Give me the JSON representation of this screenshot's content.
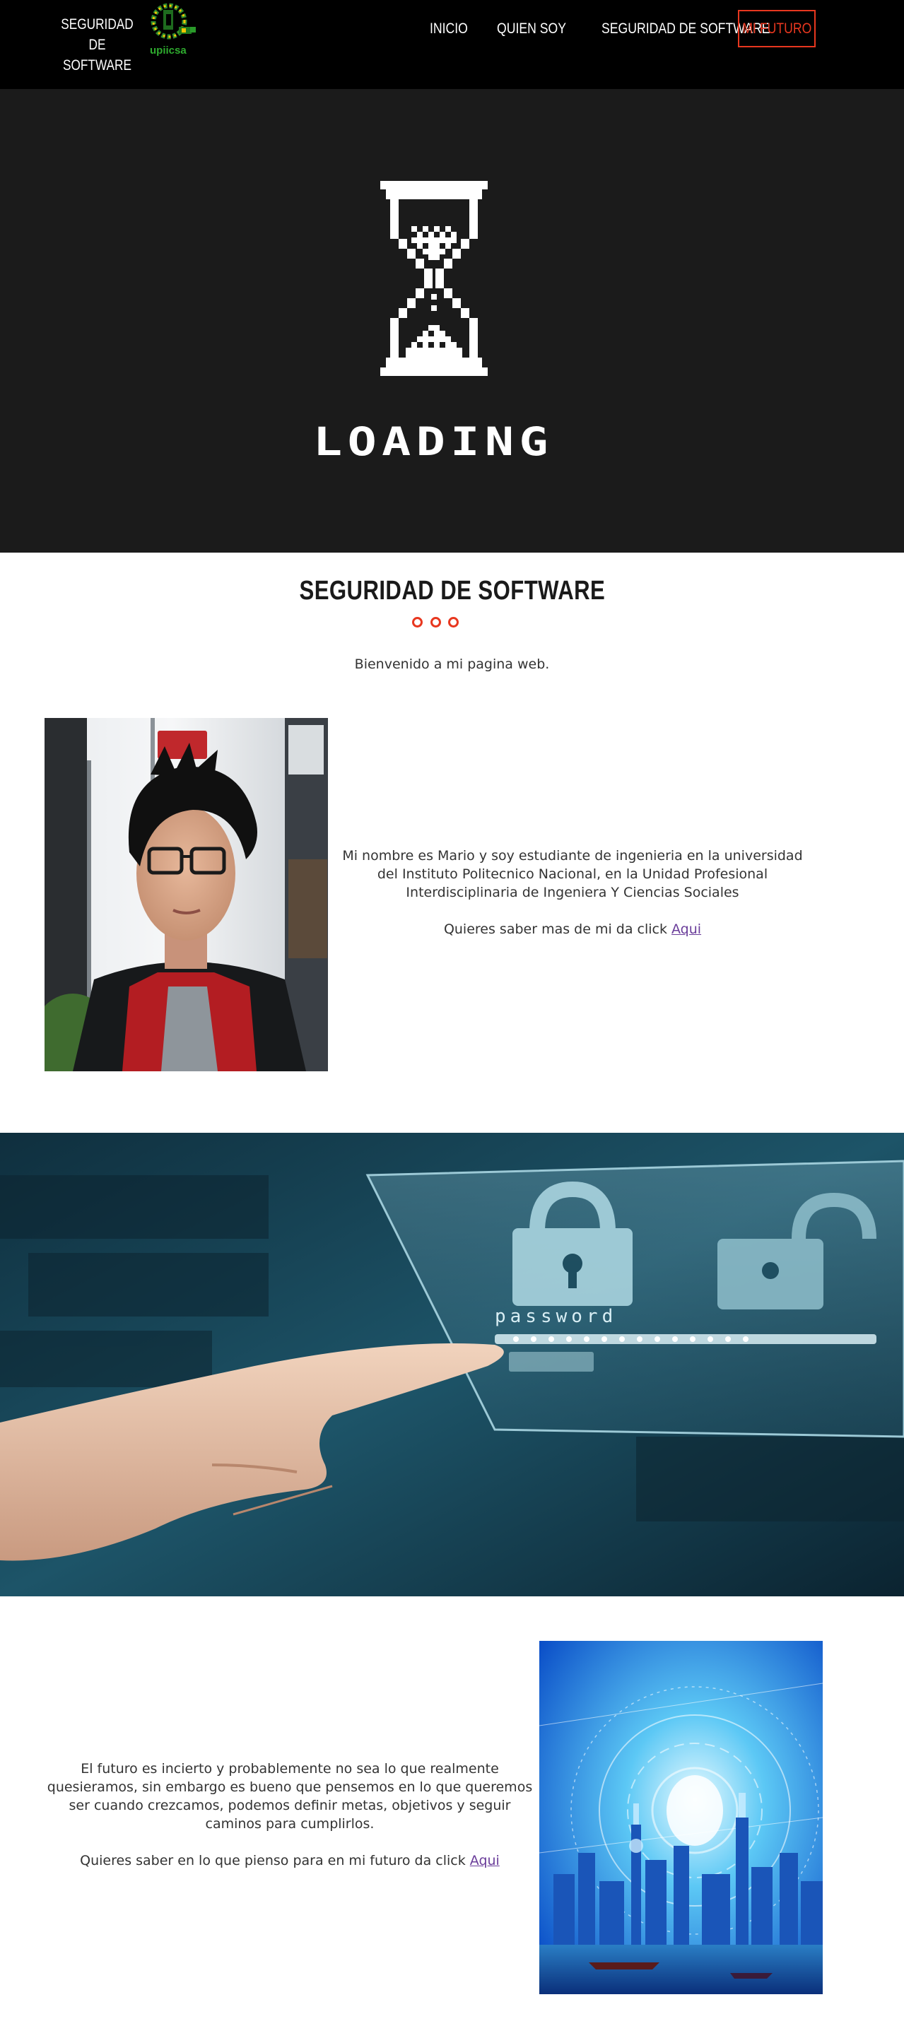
{
  "header": {
    "brand_line1": "SEGURIDAD DE",
    "brand_line2": "SOFTWARE",
    "logo_text": "upiicsa",
    "nav": [
      {
        "label": "INICIO"
      },
      {
        "label": "QUIEN SOY"
      },
      {
        "label": "SEGURIDAD DE SOFTWARE"
      }
    ],
    "cta_label": "MI FUTURO"
  },
  "hero": {
    "loading_text": "LOADING",
    "icon": "hourglass-icon"
  },
  "intro": {
    "title": "SEGURIDAD DE SOFTWARE",
    "welcome": "Bienvenido a mi pagina web.",
    "about_text": "Mi nombre es Mario y soy estudiante de ingenieria en la universidad del Instituto Politecnico Nacional, en la Unidad Profesional Interdisciplinaria de Ingeniera Y Ciencias Sociales",
    "about_link_prefix": "Quieres saber mas de mi da click ",
    "about_link_label": "Aqui"
  },
  "future": {
    "text": "El futuro es incierto y probablemente no sea lo que realmente quesieramos, sin embargo es bueno que pensemos en lo que queremos ser cuando crezcamos, podemos definir metas, objetivos y seguir caminos para cumplirlos.",
    "link_prefix": "Quieres saber en lo que pienso para en mi futuro da click ",
    "link_label": "Aqui"
  },
  "banner": {
    "password_label": "password"
  },
  "colors": {
    "accent": "#e8371f",
    "navbar_bg": "#000000",
    "hero_bg": "#1b1b1b",
    "link": "#6a3d9a"
  }
}
